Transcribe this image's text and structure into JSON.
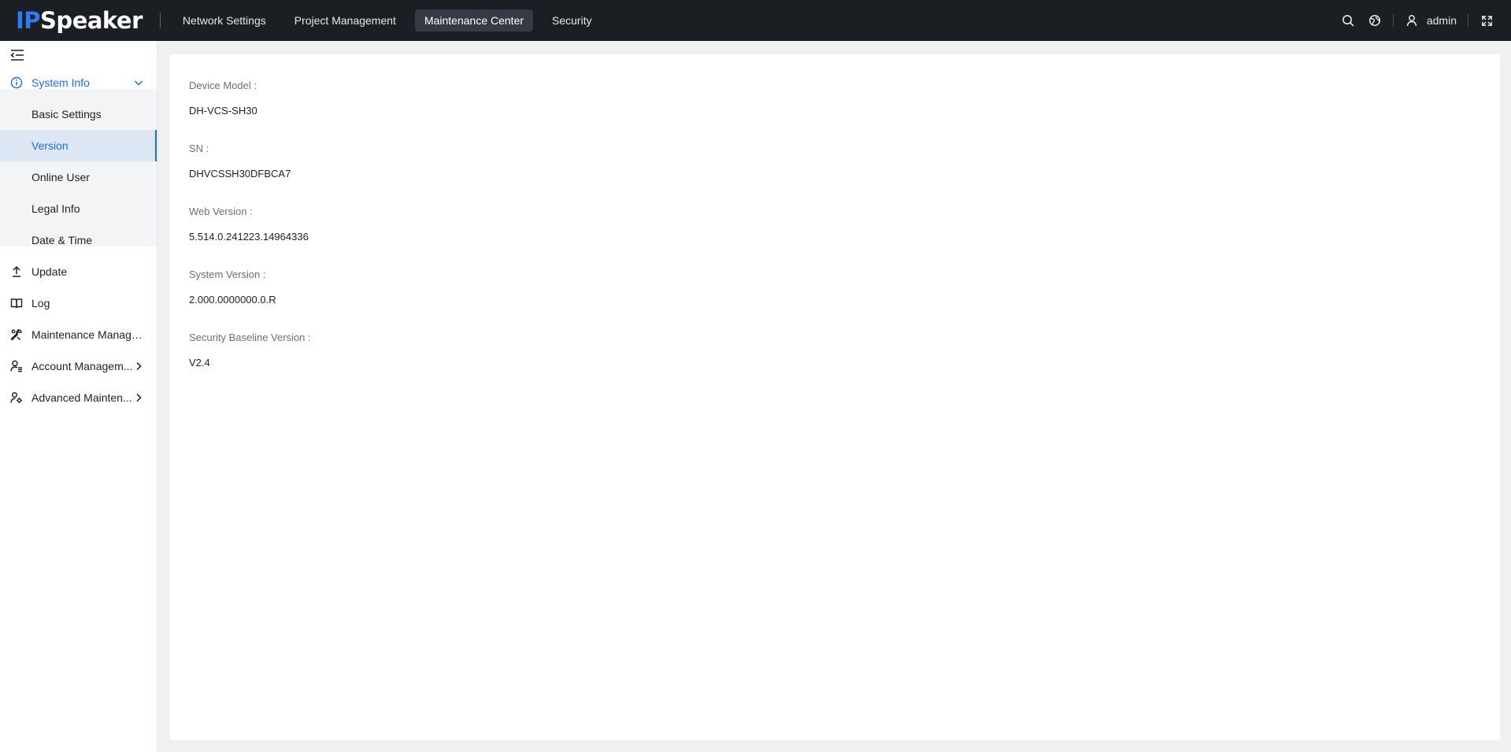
{
  "header": {
    "logo_ip": "IP",
    "logo_speaker": "Speaker",
    "nav": [
      {
        "label": "Network Settings",
        "active": false
      },
      {
        "label": "Project Management",
        "active": false
      },
      {
        "label": "Maintenance Center",
        "active": true
      },
      {
        "label": "Security",
        "active": false
      }
    ],
    "user": "admin",
    "icons": [
      "search-icon",
      "globe-icon",
      "user-icon",
      "fullscreen-icon"
    ]
  },
  "sidebar": {
    "collapse_icon": "menu-collapse-icon",
    "items": [
      {
        "label": "System Info",
        "icon": "info-icon",
        "expanded": true
      },
      {
        "label": "Update",
        "icon": "upload-icon"
      },
      {
        "label": "Log",
        "icon": "book-icon"
      },
      {
        "label": "Maintenance Manage...",
        "icon": "wrench-icon"
      },
      {
        "label": "Account Managem...",
        "icon": "user-list-icon",
        "has_children": true
      },
      {
        "label": "Advanced Mainten...",
        "icon": "advanced-maintenance-icon",
        "has_children": true
      }
    ],
    "subitems": [
      {
        "label": "Basic Settings",
        "selected": false
      },
      {
        "label": "Version",
        "selected": true
      },
      {
        "label": "Online User",
        "selected": false
      },
      {
        "label": "Legal Info",
        "selected": false
      },
      {
        "label": "Date & Time",
        "selected": false
      }
    ]
  },
  "content": {
    "fields": [
      {
        "label": "Device Model :",
        "value": "DH-VCS-SH30"
      },
      {
        "label": "SN :",
        "value": "DHVCSSH30DFBCA7"
      },
      {
        "label": "Web Version :",
        "value": "5.514.0.241223.14964336"
      },
      {
        "label": "System Version :",
        "value": "2.000.0000000.0.R"
      },
      {
        "label": "Security Baseline Version :",
        "value": "V2.4"
      }
    ]
  },
  "colors": {
    "accent": "#1d6fe0",
    "topbar": "#1b1e23",
    "logo_ip": "#2f7bf5"
  }
}
